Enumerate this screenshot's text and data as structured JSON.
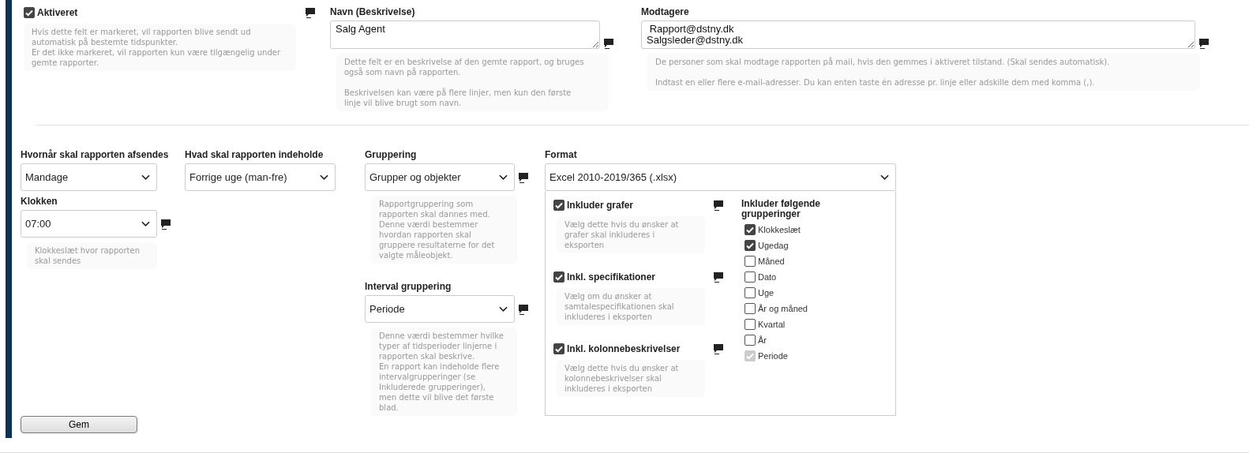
{
  "activated": {
    "label": "Aktiveret",
    "checked": true,
    "help": "Hvis dette felt er markeret, vil rapporten blive sendt ud automatisk på bestemte tidspunkter.\nEr det ikke markeret, vil rapporten kun være tilgængelig under gemte rapporter."
  },
  "name_field": {
    "label": "Navn (Beskrivelse)",
    "value": "Salg Agent",
    "help": "Dette felt er en beskrivelse af den gemte rapport, og bruges også som navn på rapporten.\n\nBeskrivelsen kan være på flere linjer, men kun den første linje vil blive brugt som navn."
  },
  "recipients": {
    "label": "Modtagere",
    "value": " Rapport@dstny.dk\nSalgsleder@dstny.dk",
    "help": "De personer som skal modtage rapporten på mail, hvis den gemmes i aktiveret tilstand. (Skal sendes automatisk).\n\nIndtast en eller flere e-mail-adresser. Du kan enten taste én adresse pr. linje eller adskille dem med komma (,)."
  },
  "when": {
    "label": "Hvornår skal rapporten afsendes",
    "value": "Mandage"
  },
  "time": {
    "label": "Klokken",
    "value": "07:00",
    "help": "Klokkeslæt hvor rapporten skal sendes"
  },
  "contents": {
    "label": "Hvad skal rapporten indeholde",
    "value": "Forrige uge (man-fre)"
  },
  "grouping": {
    "label": "Gruppering",
    "value": "Grupper og objekter",
    "help": "Rapportgruppering som rapporten skal dannes med.\nDenne værdi bestemmer hvordan rapporten skal gruppere resultaterne for det valgte måleobjekt."
  },
  "interval_grouping": {
    "label": "Interval gruppering",
    "value": "Periode",
    "help": "Denne værdi bestemmer hvilke typer af tidsperioder linjerne i rapporten skal beskrive.\nEn rapport kan indeholde flere intervalgrupperinger (se Inkluderede grupperinger), men dette vil blive det første blad."
  },
  "format": {
    "label": "Format",
    "value": "Excel 2010-2019/365 (.xlsx)",
    "options": [
      {
        "label": "Inkluder grafer",
        "checked": true,
        "help": "Vælg dette hvis du ønsker at grafer skal inkluderes i eksporten"
      },
      {
        "label": "Inkl. specifikationer",
        "checked": true,
        "help": "Vælg om du ønsker at samtalespecifikationen skal inkluderes i eksporten"
      },
      {
        "label": "Inkl. kolonnebeskrivelser",
        "checked": true,
        "help": "Vælg dette hvis du ønsker at kolonnebeskrivelser skal inkluderes i eksporten"
      }
    ],
    "groupings_title": "Inkluder følgende grupperinger",
    "groupings": [
      {
        "label": "Klokkeslæt",
        "checked": true,
        "disabled": false
      },
      {
        "label": "Ugedag",
        "checked": true,
        "disabled": false
      },
      {
        "label": "Måned",
        "checked": false,
        "disabled": false
      },
      {
        "label": "Dato",
        "checked": false,
        "disabled": false
      },
      {
        "label": "Uge",
        "checked": false,
        "disabled": false
      },
      {
        "label": "År og måned",
        "checked": false,
        "disabled": false
      },
      {
        "label": "Kvartal",
        "checked": false,
        "disabled": false
      },
      {
        "label": "År",
        "checked": false,
        "disabled": false
      },
      {
        "label": "Periode",
        "checked": true,
        "disabled": true
      }
    ]
  },
  "save_button": "Gem"
}
